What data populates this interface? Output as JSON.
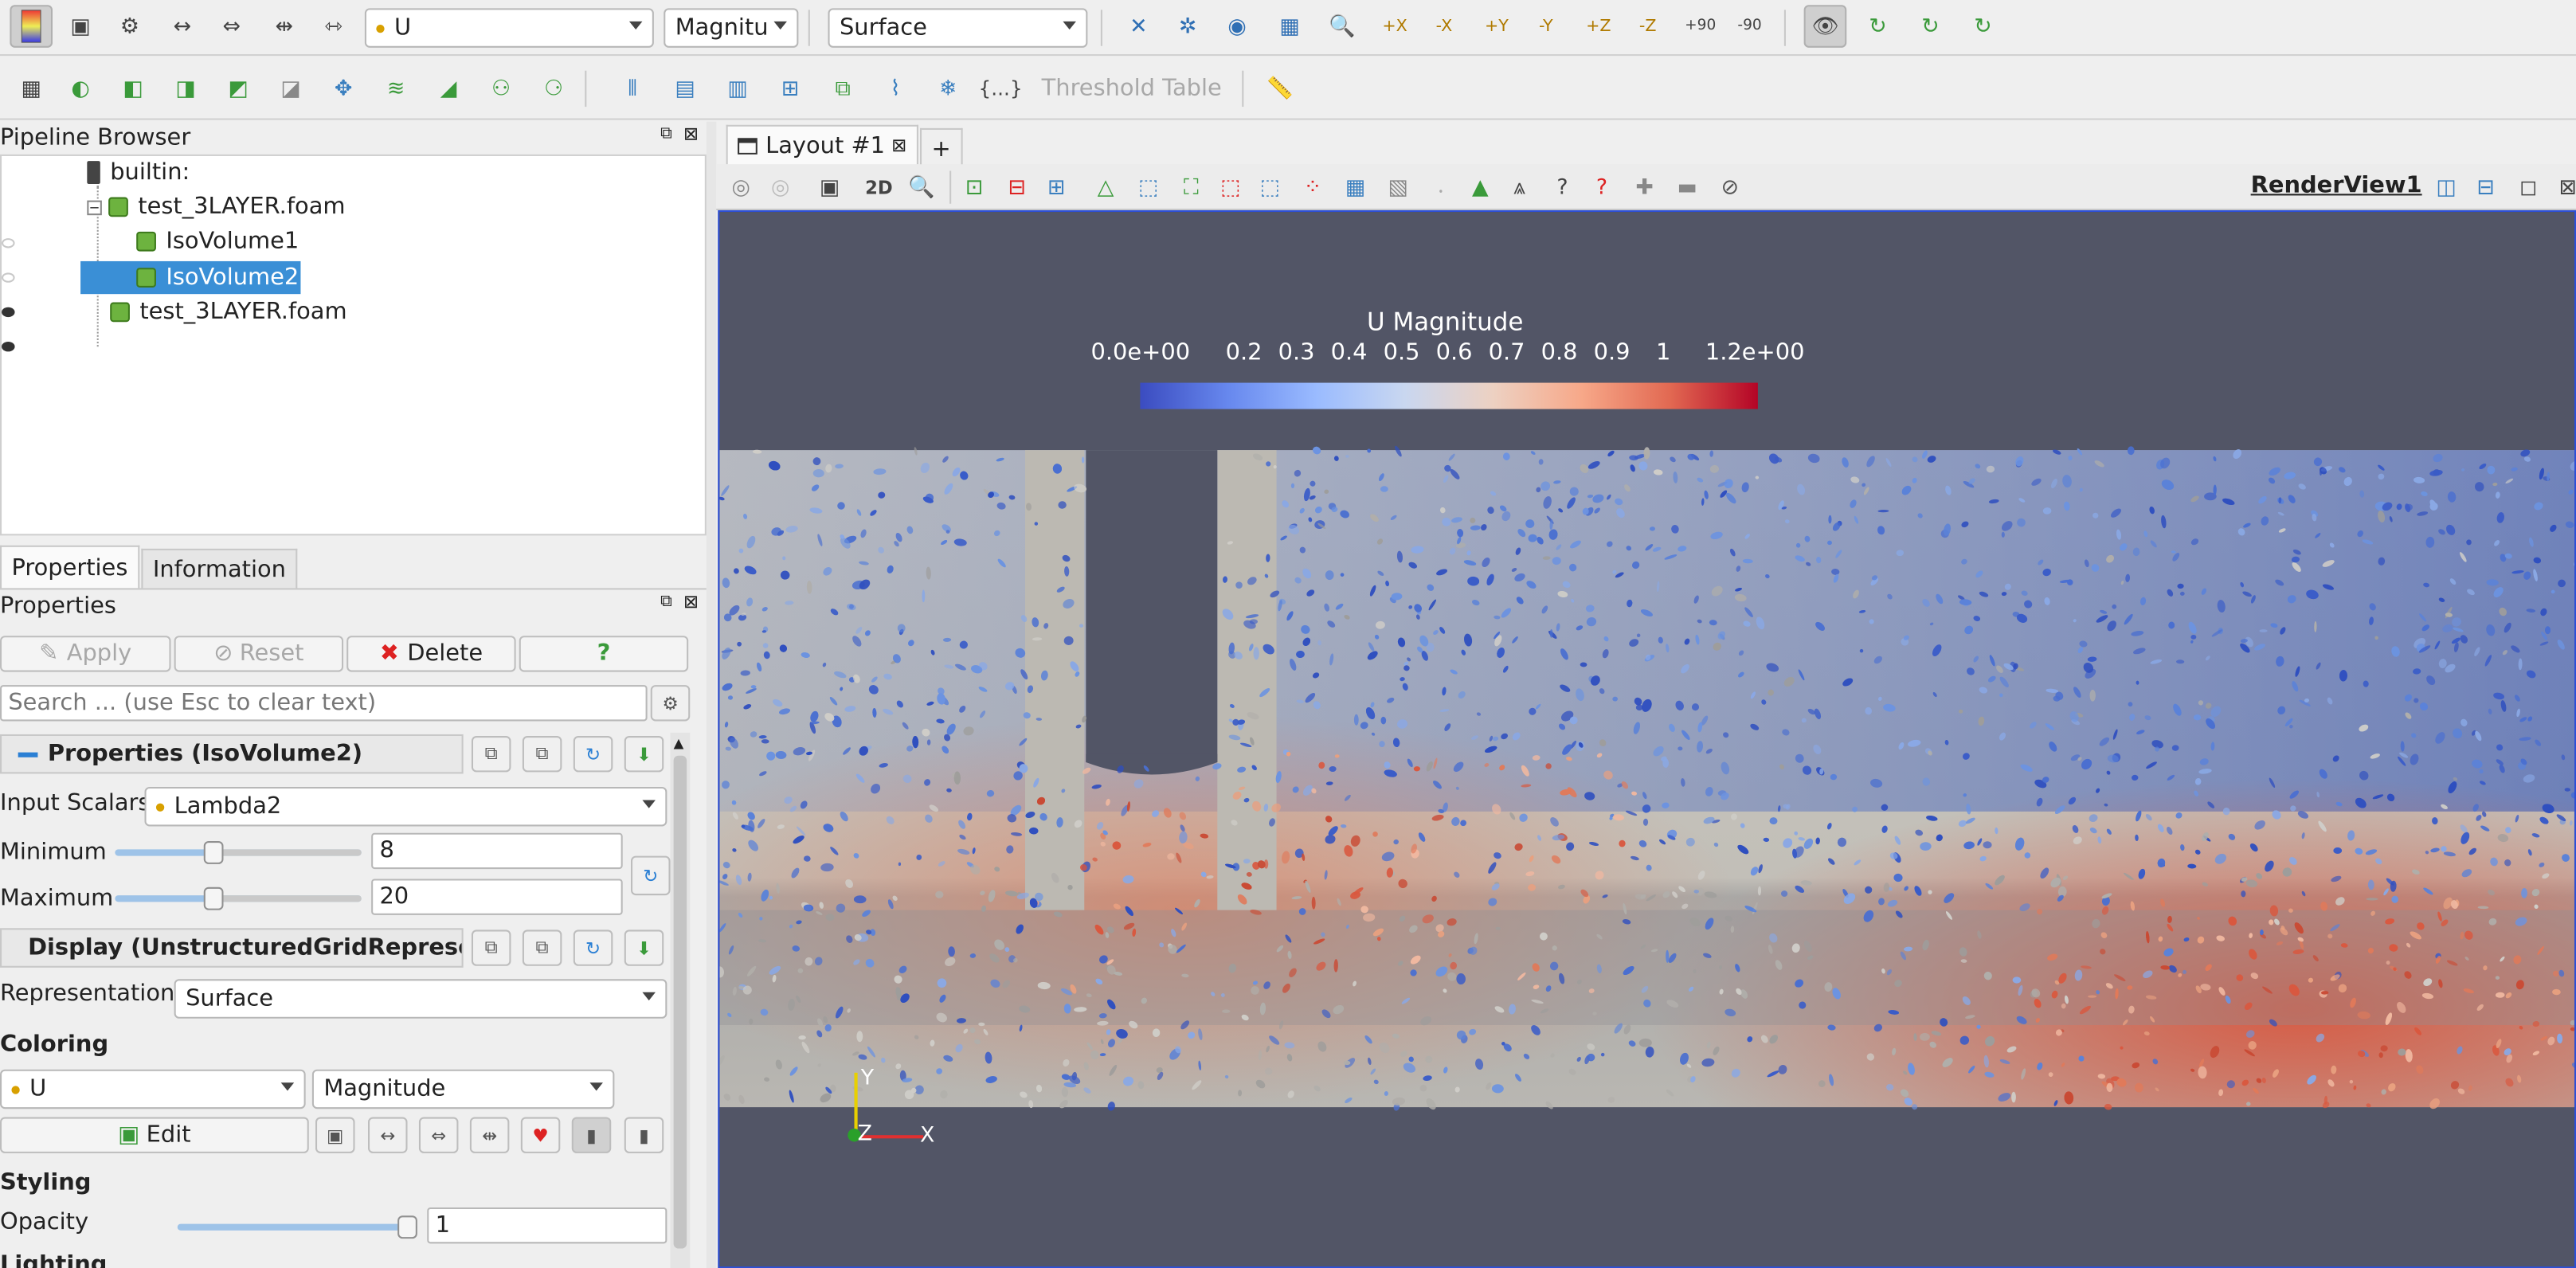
{
  "toolbar_top": {
    "array_combo": "U",
    "component_combo": "Magnitu",
    "representation_combo": "Surface",
    "rotate_labels": [
      "+X",
      "-X",
      "+Y",
      "-Y",
      "+Z",
      "-Z",
      "+90",
      "-90"
    ]
  },
  "toolbar_second": {
    "threshold_table_label": "Threshold Table",
    "braces_label": "{...}"
  },
  "pipeline": {
    "title": "Pipeline Browser",
    "items": [
      {
        "label": "builtin:"
      },
      {
        "label": "test_3LAYER.foam"
      },
      {
        "label": "IsoVolume1"
      },
      {
        "label": "IsoVolume2"
      },
      {
        "label": "test_3LAYER.foam"
      }
    ]
  },
  "tabs": {
    "properties": "Properties",
    "information": "Information"
  },
  "properties": {
    "title": "Properties",
    "apply": "Apply",
    "reset": "Reset",
    "delete": "Delete",
    "help": "?",
    "search_placeholder": "Search ... (use Esc to clear text)",
    "section_props": "Properties (IsoVolume2)",
    "input_scalars_label": "Input Scalars",
    "input_scalars_value": "Lambda2",
    "minimum_label": "Minimum",
    "minimum_value": "8",
    "maximum_label": "Maximum",
    "maximum_value": "20",
    "section_display": "Display (UnstructuredGridRepresen",
    "representation_label": "Representation",
    "representation_value": "Surface",
    "coloring_label": "Coloring",
    "color_array": "U",
    "color_component": "Magnitude",
    "edit_label": "Edit",
    "styling_label": "Styling",
    "opacity_label": "Opacity",
    "opacity_value": "1",
    "lighting_label": "Lighting",
    "minimum_slider_fraction": 0.4,
    "maximum_slider_fraction": 0.4,
    "opacity_slider_fraction": 1.0
  },
  "layout": {
    "tab_label": "Layout #1",
    "new_tab": "+",
    "view_2d": "2D",
    "render_view_label": "RenderView1"
  },
  "colorbar": {
    "title": "U Magnitude",
    "ticks": [
      "0.0e+00",
      "0.2",
      "0.3",
      "0.4",
      "0.5",
      "0.6",
      "0.7",
      "0.8",
      "0.9",
      "1",
      "1.2e+00"
    ]
  },
  "axes": {
    "y": "Y",
    "z": "Z",
    "x": "X"
  },
  "colors": {
    "selection": "#3a8fd6",
    "view_background": "#525566",
    "accent_blue": "#2a7fd4"
  }
}
